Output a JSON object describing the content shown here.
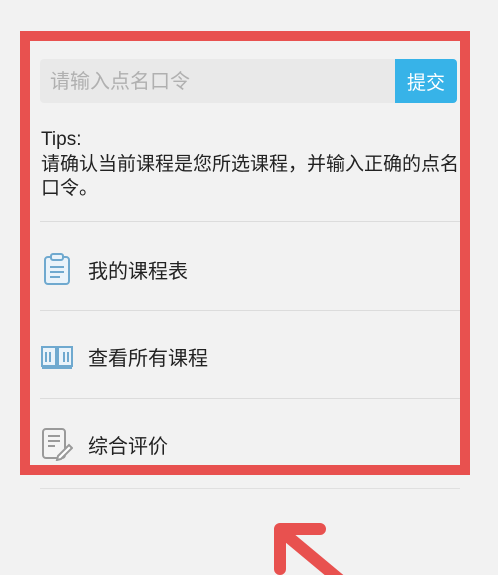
{
  "search": {
    "placeholder": "请输入点名口令",
    "submit_label": "提交"
  },
  "tips": {
    "title": "Tips:",
    "text": "请确认当前课程是您所选课程，并输入正确的点名口令。"
  },
  "menu": {
    "items": [
      {
        "label": "我的课程表",
        "icon": "clipboard-icon"
      },
      {
        "label": "查看所有课程",
        "icon": "open-book-icon"
      },
      {
        "label": "综合评价",
        "icon": "document-edit-icon"
      }
    ]
  },
  "colors": {
    "accent": "#37b3e8",
    "highlight": "#e8514f",
    "icon": "#6fa9cf"
  }
}
